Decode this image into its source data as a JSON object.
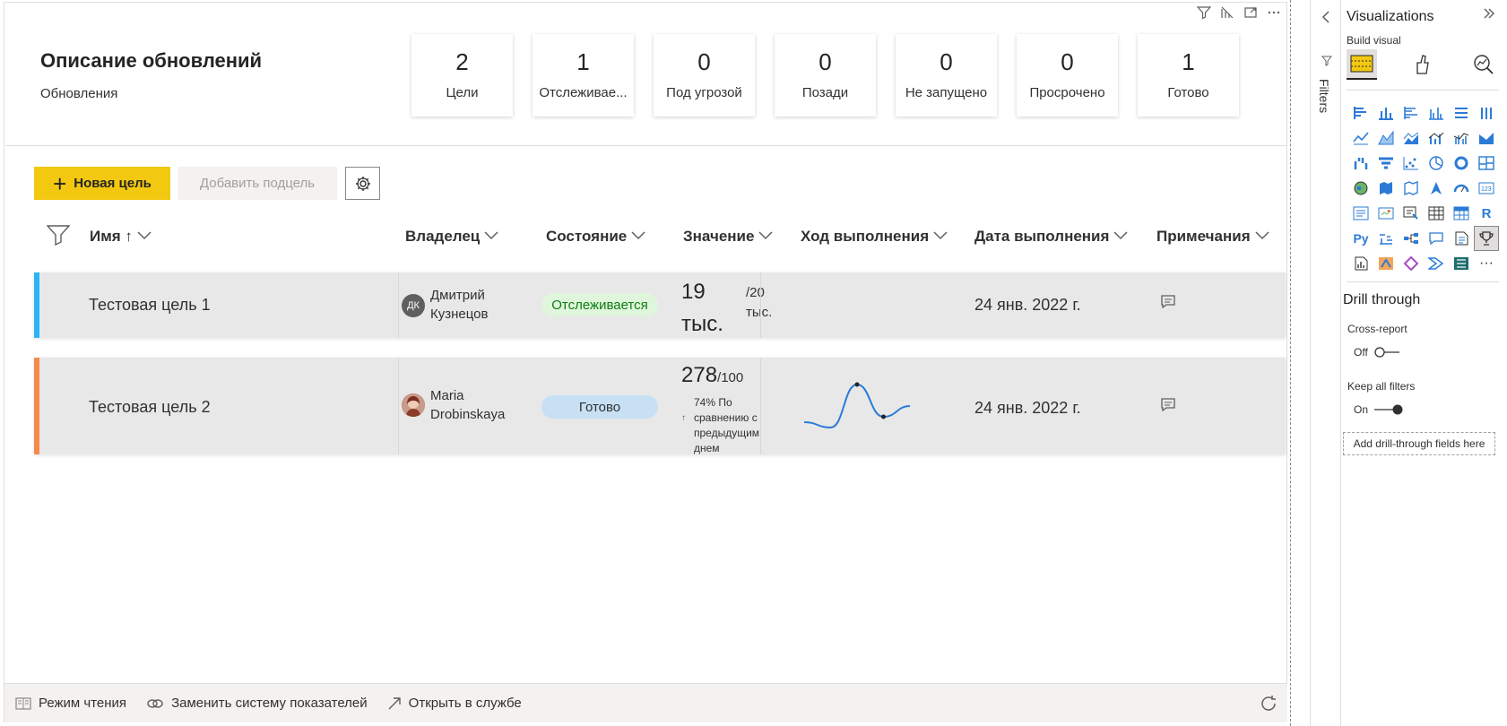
{
  "scorecard": {
    "title": "Описание обновлений",
    "subtitle": "Обновления"
  },
  "kpis": [
    {
      "value": "2",
      "label": "Цели"
    },
    {
      "value": "1",
      "label": "Отслеживае..."
    },
    {
      "value": "0",
      "label": "Под угрозой"
    },
    {
      "value": "0",
      "label": "Позади"
    },
    {
      "value": "0",
      "label": "Не запущено"
    },
    {
      "value": "0",
      "label": "Просрочено"
    },
    {
      "value": "1",
      "label": "Готово"
    }
  ],
  "toolbar": {
    "new_goal": "Новая цель",
    "add_subgoal": "Добавить подцель"
  },
  "columns": {
    "name": "Имя ↑",
    "owner": "Владелец",
    "status": "Состояние",
    "value": "Значение",
    "progress": "Ход выполнения",
    "due_date": "Дата выполнения",
    "notes": "Примечания"
  },
  "rows": [
    {
      "name": "Тестовая цель 1",
      "owner_initials": "ДК",
      "owner_line1": "Дмитрий",
      "owner_line2": "Кузнецов",
      "status": "Отслеживается",
      "value_line1": "19",
      "value_line2": "тыс.",
      "target_line1": "/20",
      "target_line2": "тыс.",
      "due_date": "24 янв. 2022 г.",
      "stripe_color": "#29b6f6",
      "status_bg": "#dff6dd",
      "status_color": "#107c10"
    },
    {
      "name": "Тестовая цель 2",
      "owner_line1": "Maria",
      "owner_line2": "Drobinskaya",
      "status": "Готово",
      "value": "278",
      "target": "/100",
      "change_line1": "74% По",
      "change_line2": "сравнению с",
      "change_line3": "предыдущим",
      "change_line4": "днем",
      "change_arrow": "↑",
      "due_date": "24 янв. 2022 г.",
      "stripe_color": "#f7894a",
      "status_bg": "#c7e0f4",
      "status_color": "#323130",
      "sparkline": [
        2,
        1,
        9,
        3,
        5
      ]
    }
  ],
  "footer": {
    "reading_mode": "Режим чтения",
    "replace_scorecard": "Заменить систему показателей",
    "open_in_service": "Открыть в службе"
  },
  "filters_pane": {
    "label": "Filters"
  },
  "viz_pane": {
    "title": "Visualizations",
    "build_visual": "Build visual",
    "drill_through": "Drill through",
    "cross_report": "Cross-report",
    "cross_report_state": "Off",
    "keep_all_filters": "Keep all filters",
    "keep_filters_state": "On",
    "drill_field_placeholder": "Add drill-through fields here"
  }
}
